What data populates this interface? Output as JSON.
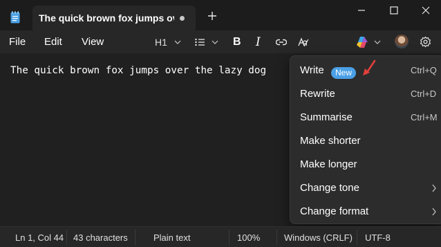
{
  "window": {
    "tab_title": "The quick brown fox jumps over",
    "accent_color": "#4aa0e6"
  },
  "menu": {
    "file": "File",
    "edit": "Edit",
    "view": "View"
  },
  "toolbar": {
    "heading": "H1",
    "icons": [
      "chevron-down-icon",
      "list-icon",
      "bold-icon",
      "italic-icon",
      "link-icon",
      "clear-formatting-icon",
      "copilot-icon",
      "settings-icon"
    ]
  },
  "document": {
    "text": "The quick brown fox jumps over the lazy dog"
  },
  "copilot_menu": {
    "items": [
      {
        "label": "Write",
        "badge": "New",
        "shortcut": "Ctrl+Q"
      },
      {
        "label": "Rewrite",
        "shortcut": "Ctrl+D"
      },
      {
        "label": "Summarise",
        "shortcut": "Ctrl+M"
      },
      {
        "label": "Make shorter"
      },
      {
        "label": "Make longer"
      },
      {
        "label": "Change tone",
        "submenu": true
      },
      {
        "label": "Change format",
        "submenu": true
      }
    ],
    "annotation_color": "#e0403a"
  },
  "status": {
    "position": "Ln 1, Col 44",
    "characters": "43 characters",
    "format": "Plain text",
    "zoom": "100%",
    "line_ending": "Windows (CRLF)",
    "encoding": "UTF-8"
  }
}
